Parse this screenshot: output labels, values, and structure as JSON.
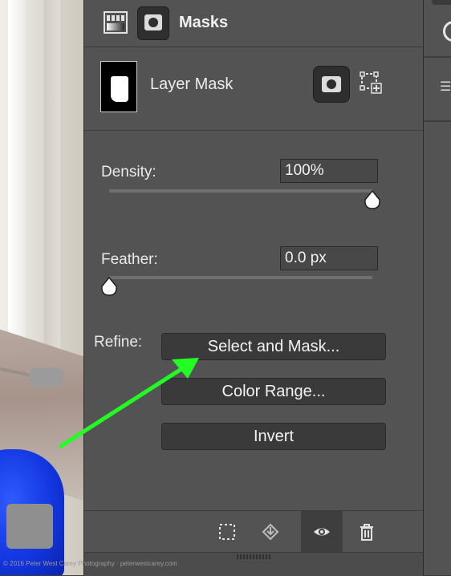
{
  "header": {
    "title": "Masks",
    "icons": [
      "gradient-icon",
      "mask-icon"
    ]
  },
  "layer": {
    "label": "Layer Mask",
    "icons": [
      "pixel-mask-icon",
      "vector-mask-icon"
    ]
  },
  "density": {
    "label": "Density:",
    "value": "100%",
    "level_percent": 100
  },
  "feather": {
    "label": "Feather:",
    "value": "0.0 px",
    "level_percent": 0
  },
  "refine": {
    "label": "Refine:",
    "buttons": [
      "Select and Mask...",
      "Color Range...",
      "Invert"
    ]
  },
  "footer": {
    "icons": [
      "load-selection-icon",
      "apply-mask-icon",
      "visibility-eye-icon",
      "trash-icon"
    ]
  },
  "watermark": "© 2016 Peter West Carey Photography · peterwestcarey.com",
  "colors": {
    "panel_bg": "#535353",
    "button_bg": "#3a3a3a",
    "annotation_arrow": "#22ff22"
  }
}
